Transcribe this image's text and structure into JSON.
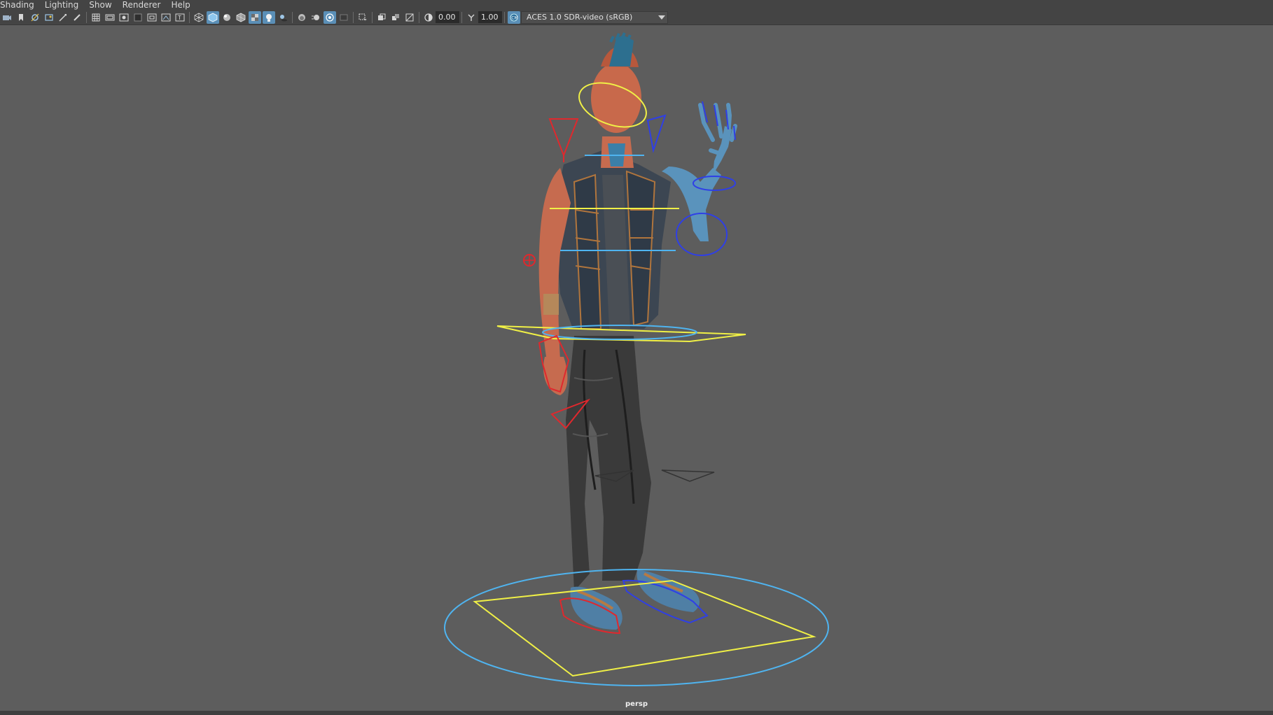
{
  "menubar": {
    "items": [
      "Shading",
      "Lighting",
      "Show",
      "Renderer",
      "Help"
    ]
  },
  "toolbar": {
    "exposure_value": "0.00",
    "gamma_value": "1.00",
    "color_space": "ACES 1.0 SDR-video (sRGB)",
    "icons": [
      "camera-select-icon",
      "bookmark-icon",
      "camera-attributes-icon",
      "image-plane-icon",
      "2d-pan-zoom-icon",
      "grease-pencil-icon",
      "grid-icon",
      "film-gate-icon",
      "resolution-gate-icon",
      "gate-mask-icon",
      "field-chart-icon",
      "safe-action-icon",
      "wireframe-icon",
      "smooth-shade-icon",
      "use-default-material-icon",
      "wireframe-on-shaded-icon",
      "textured-icon",
      "lights-icon",
      "shadows-icon",
      "screen-space-ao-icon",
      "motion-blur-icon",
      "anti-aliasing-icon",
      "depth-of-field-icon",
      "isolate-select-icon",
      "xray-icon",
      "xray-joints-icon",
      "xray-active-icon",
      "exposure-icon",
      "gamma-icon",
      "color-management-icon"
    ],
    "accent": "#5a8fb7"
  },
  "viewport": {
    "camera_label": "persp",
    "background": "#5d5d5d"
  },
  "colors": {
    "control_yellow": "#f0f046",
    "control_cyan": "#4fb4f0",
    "control_red": "#e0282d",
    "control_blue": "#2f3fe6"
  }
}
